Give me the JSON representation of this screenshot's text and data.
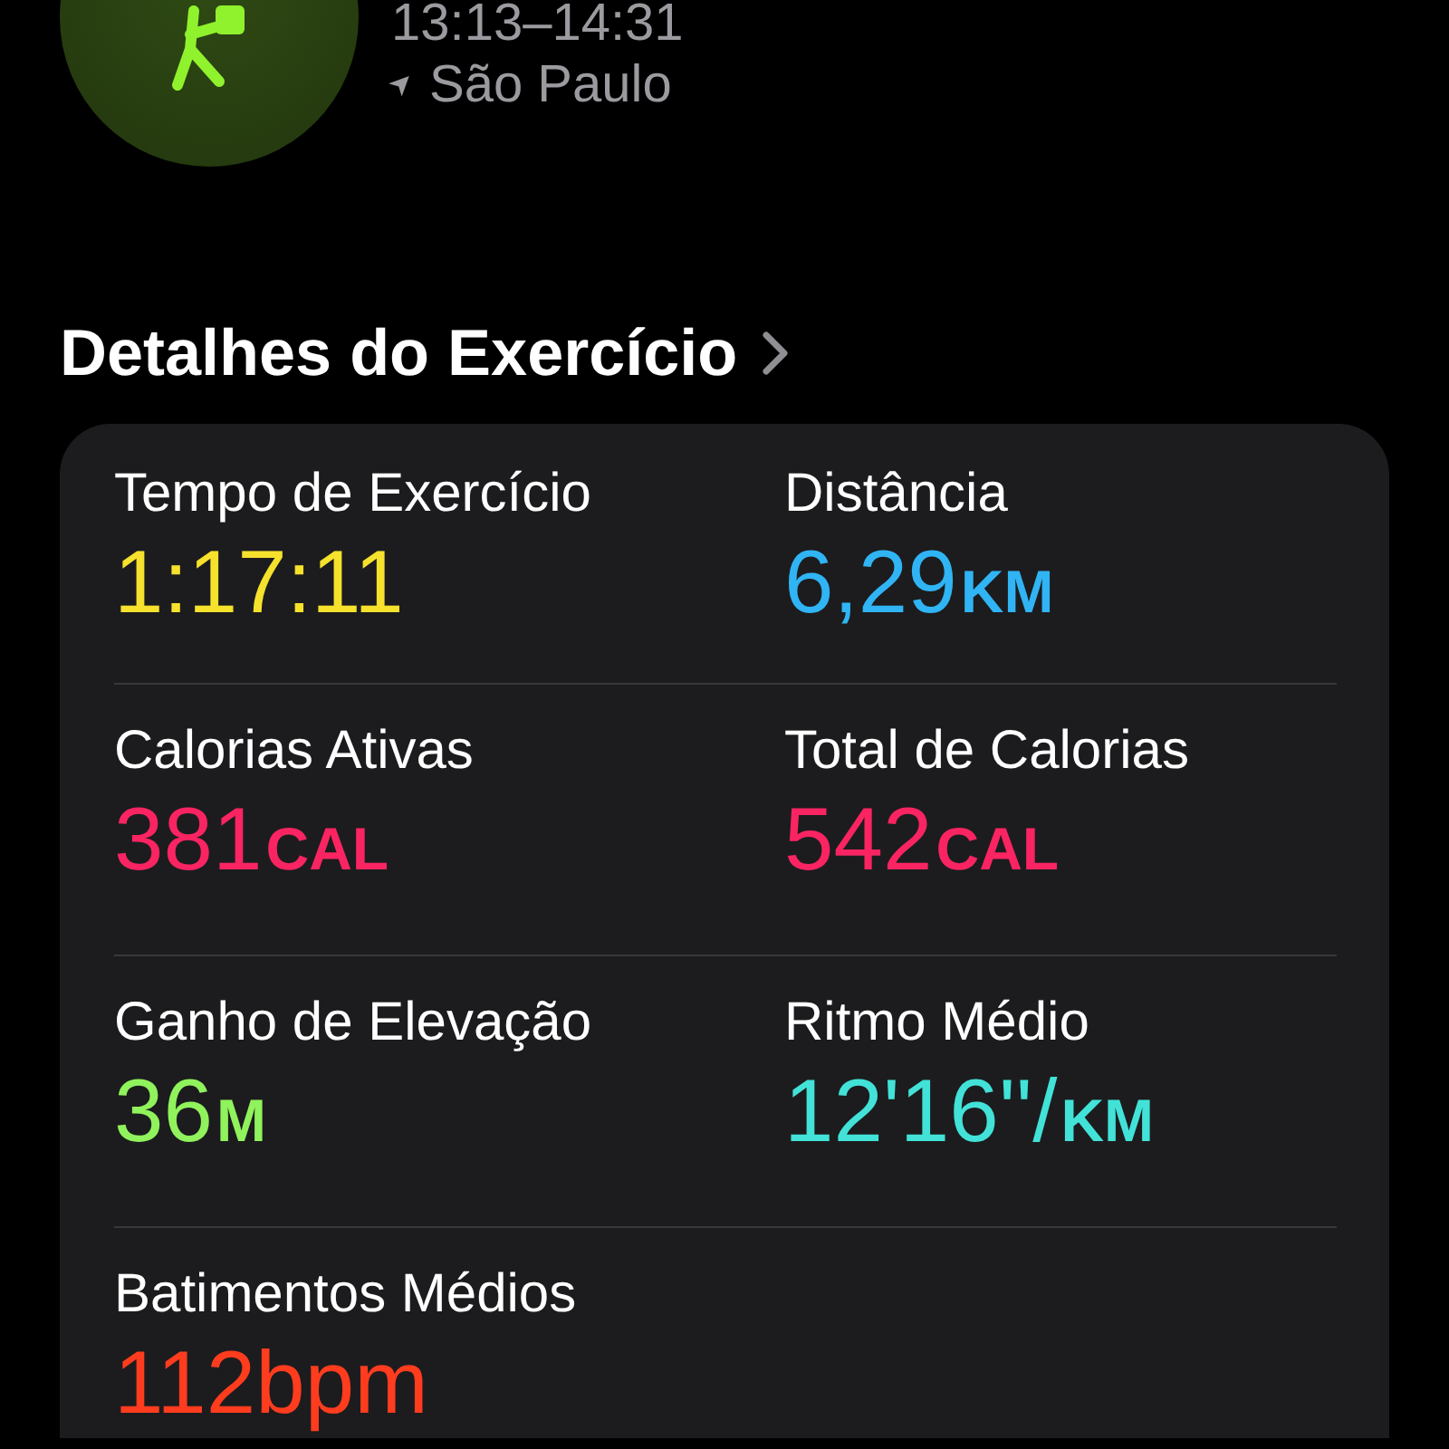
{
  "workout": {
    "time_range": "13:13–14:31",
    "location_arrow": "➤",
    "location": "São Paulo"
  },
  "section": {
    "title": "Detalhes do Exercício"
  },
  "metrics": [
    {
      "label": "Tempo de Exercício",
      "value": "1:17:11",
      "color": "#f6e12c"
    },
    {
      "label": "Distância",
      "value": "6,29",
      "unit": "KM",
      "color": "#30b4f4"
    },
    {
      "label": "Calorias Ativas",
      "value": "381",
      "unit": "CAL",
      "color": "#fa2462"
    },
    {
      "label": "Total de Calorias",
      "value": "542",
      "unit": "CAL",
      "color": "#fa2462"
    },
    {
      "label": "Ganho de Elevação",
      "value": "36",
      "unit": "M",
      "color": "#90f25c"
    },
    {
      "label": "Ritmo Médio",
      "value": "12'16''/",
      "unit": "KM",
      "color": "#42e2d8"
    },
    {
      "label": "Batimentos Médios",
      "value": "112bpm",
      "color": "#ff3c1e"
    }
  ]
}
